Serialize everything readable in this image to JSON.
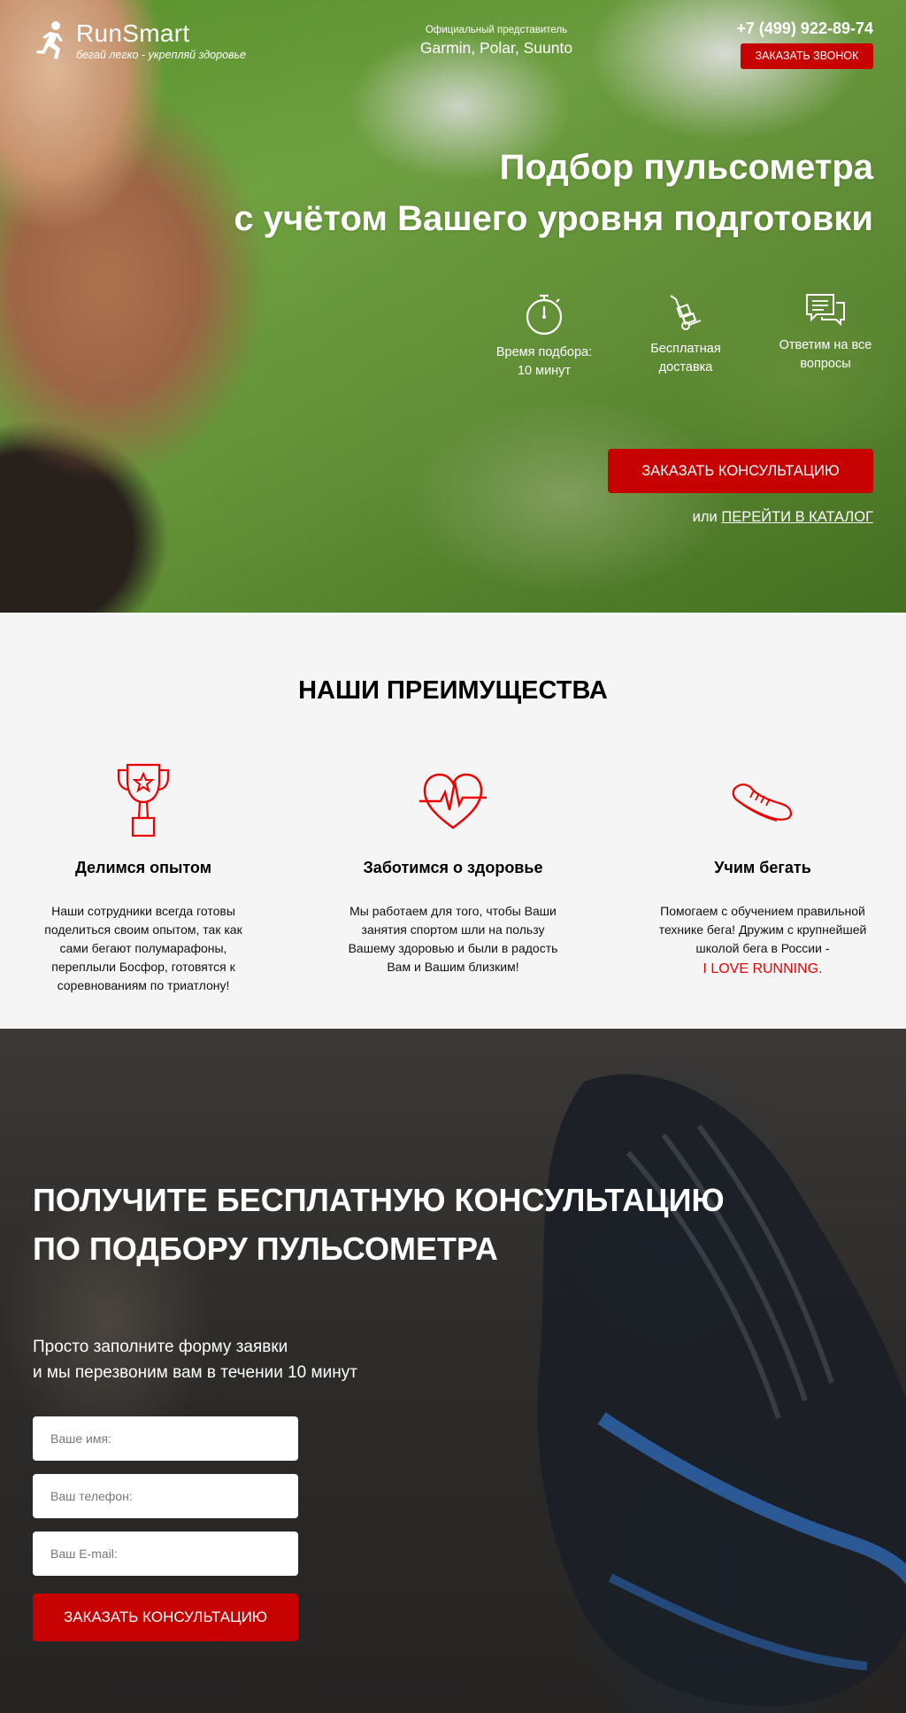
{
  "header": {
    "logo_name": "RunSmart",
    "logo_tagline": "бегай легко - укрепляй здоровье",
    "representative_label": "Официальный представитель",
    "representative_brands": "Garmin, Polar, Suunto",
    "phone": "+7 (499) 922-89-74",
    "callback_button": "ЗАКАЗАТЬ ЗВОНОК"
  },
  "hero": {
    "title_line1": "Подбор пульсометра",
    "title_line2": "с учётом Вашего уровня подготовки",
    "features": [
      {
        "icon": "stopwatch-icon",
        "line1": "Время подбора:",
        "line2": "10 минут"
      },
      {
        "icon": "hand-truck-icon",
        "line1": "Бесплатная",
        "line2": "доставка"
      },
      {
        "icon": "chat-bubbles-icon",
        "line1": "Ответим на все",
        "line2": "вопросы"
      }
    ],
    "consult_button": "ЗАКАЗАТЬ КОНСУЛЬТАЦИЮ",
    "or_text": "или",
    "catalog_link": "ПЕРЕЙТИ В КАТАЛОГ"
  },
  "advantages": {
    "title": "НАШИ ПРЕИМУЩЕСТВА",
    "items": [
      {
        "icon": "trophy-icon",
        "heading": "Делимся опытом",
        "text": "Наши сотрудники всегда готовы поделиться своим опытом, так как сами бегают полумарафоны, переплыли Босфор, готовятся к соревнованиям по триатлону!"
      },
      {
        "icon": "heart-pulse-icon",
        "heading": "Заботимся о здоровье",
        "text": "Мы работаем для того, чтобы Ваши занятия спортом шли на пользу Вашему здоровью и были в радость Вам и Вашим близким!"
      },
      {
        "icon": "running-shoe-icon",
        "heading": "Учим бегать",
        "text": "Помогаем с обучением правильной технике бега! Дружим с крупнейшей школой бега в России -",
        "accent": "I LOVE RUNNING."
      }
    ]
  },
  "consult_form": {
    "title_line1": "ПОЛУЧИТЕ БЕСПЛАТНУЮ КОНСУЛЬТАЦИЮ",
    "title_line2": "ПО ПОДБОРУ ПУЛЬСОМЕТРА",
    "subtitle_line1": "Просто заполните форму заявки",
    "subtitle_line2": "и мы перезвоним вам в течении 10 минут",
    "name_placeholder": "Ваше имя:",
    "phone_placeholder": "Ваш телефон:",
    "email_placeholder": "Ваш E-mail:",
    "submit_button": "ЗАКАЗАТЬ КОНСУЛЬТАЦИЮ"
  },
  "colors": {
    "accent": "#c70101",
    "accent_text": "#e00000",
    "advantages_bg": "#f5f5f5"
  }
}
